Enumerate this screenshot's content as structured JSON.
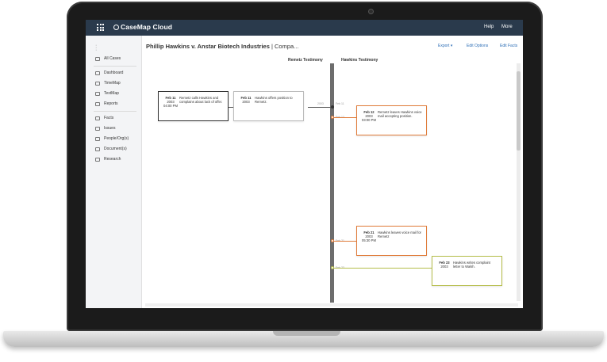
{
  "app": {
    "brand": "CaseMap Cloud",
    "help_label": "Help",
    "more_label": "More"
  },
  "sidebar": {
    "items": [
      {
        "label": "All Cases",
        "icon": "list-icon"
      },
      {
        "label": "Dashboard",
        "icon": "dashboard-icon"
      },
      {
        "label": "TimeMap",
        "icon": "timemap-icon"
      },
      {
        "label": "TextMap",
        "icon": "textmap-icon"
      },
      {
        "label": "Reports",
        "icon": "reports-icon"
      },
      {
        "label": "Facts",
        "icon": "facts-icon"
      },
      {
        "label": "Issues",
        "icon": "issues-icon"
      },
      {
        "label": "People/Org(s)",
        "icon": "people-icon"
      },
      {
        "label": "Document(s)",
        "icon": "document-icon"
      },
      {
        "label": "Research",
        "icon": "research-icon"
      }
    ]
  },
  "page": {
    "title_case": "Phillip Hawkins v. Anstar Biotech Industries",
    "title_suffix": " | Compa...",
    "toolbar": {
      "export_label": "Export",
      "edit_options_label": "Edit Options",
      "edit_facts_label": "Edit Facts"
    }
  },
  "timeline": {
    "lanes": [
      {
        "label": "Remetz Testimony"
      },
      {
        "label": "Hawkins Testimony"
      }
    ],
    "events": [
      {
        "date": "Feb 11",
        "year": "2003",
        "time": "04:00 PM",
        "text": "Remetz calls Hawkins and complains about lack of offer.",
        "lane": "Remetz Testimony",
        "style": "selected"
      },
      {
        "date": "Feb 11",
        "year": "2003",
        "time": "",
        "text": "Hawkins offers position to Remetz.",
        "lane": "Remetz Testimony",
        "style": "default"
      },
      {
        "date": "Feb 12",
        "year": "2003",
        "time": "03:00 PM",
        "text": "Remetz leaves Hawkins voice mail accepting position.",
        "lane": "Hawkins Testimony",
        "style": "orange"
      },
      {
        "date": "Feb 21",
        "year": "2003",
        "time": "05:30 PM",
        "text": "Hawkins leaves voice mail for Remetz",
        "lane": "Hawkins Testimony",
        "style": "orange"
      },
      {
        "date": "Feb 23",
        "year": "2003",
        "time": "",
        "text": "Hawkins writes complaint letter to Walsh.",
        "lane": "Hawkins Testimony",
        "style": "green"
      }
    ],
    "axis_ticks": [
      "Feb 11",
      "Feb 12",
      "Feb 21",
      "Feb 23"
    ],
    "connector_label": "2003",
    "colors": {
      "orange": "#e07b39",
      "green": "#b5bd4a",
      "axis": "#6d6d6d"
    }
  }
}
